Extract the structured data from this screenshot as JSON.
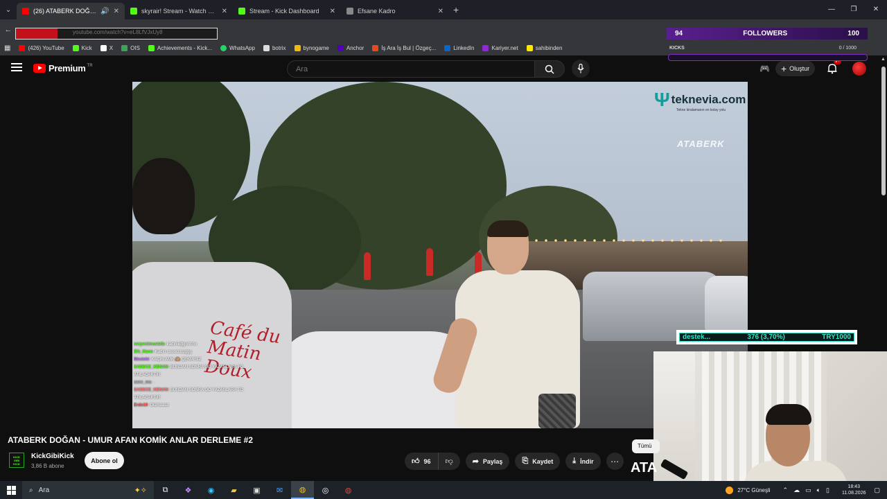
{
  "browser": {
    "tabs": [
      {
        "title": "(26) ATABERK DOĞAN - UM",
        "active": true,
        "color": "#ff0000"
      },
      {
        "title": "skyrair! Stream - Watch Live on",
        "active": false,
        "color": "#53fc18"
      },
      {
        "title": "Stream - Kick Dashboard",
        "active": false,
        "color": "#53fc18"
      },
      {
        "title": "Efsane Kadro",
        "active": false,
        "color": "#888888"
      }
    ],
    "url": "youtube.com/watch?v=eL8LfVJxUy8",
    "bookmarks": [
      {
        "label": "(426) YouTube",
        "color": "#ff0000"
      },
      {
        "label": "Kick",
        "color": "#53fc18"
      },
      {
        "label": "X",
        "color": "#ffffff"
      },
      {
        "label": "OIS",
        "color": "#3aa45a"
      },
      {
        "label": "Achievements - Kick...",
        "color": "#53fc18"
      },
      {
        "label": "WhatsApp",
        "color": "#25d366"
      },
      {
        "label": "botrix",
        "color": "#dddddd"
      },
      {
        "label": "bynogame",
        "color": "#f5b80a"
      },
      {
        "label": "Anchor",
        "color": "#5000b9"
      },
      {
        "label": "İş Ara İş Bul | Özgeç...",
        "color": "#e8481c"
      },
      {
        "label": "LinkedIn",
        "color": "#0a66c2"
      },
      {
        "label": "Kariyer.net",
        "color": "#8e2ad2"
      },
      {
        "label": "sahibinden",
        "color": "#ffe800"
      }
    ]
  },
  "overlay": {
    "followers_current": "94",
    "followers_label": "FOLLOWERS",
    "followers_goal": "100",
    "kicks_label": "KICKS",
    "kicks_value": "0 / 1000"
  },
  "youtube": {
    "premium_label": "Premium",
    "tr_label": "TR",
    "search_placeholder": "Ara",
    "create_label": "Oluştur",
    "notif_count": "9+"
  },
  "video": {
    "sponsor_name": "teknevia.com",
    "sponsor_tagline": "Tekne kiralamanın en kolay yolu",
    "watermark": "ATABERK",
    "shirt_print": "Café du Matin Doux",
    "chat": [
      {
        "user": "serpentmustafa",
        "msg": "kadıniiiiğgnnnnn",
        "color": "#53fc18"
      },
      {
        "user": "Efe_Hann",
        "msg": "Kadın cuuuccuuggg",
        "color": "#53fc18"
      },
      {
        "user": "Mestekt",
        "msg": "KAÇIN AMK 🙈 ÇEKMİSİZ",
        "color": "#c06cff"
      },
      {
        "user": "SADECE_KENAN",
        "msg": "BUNDAN SONRA GO YAZANLARA TO",
        "color": "#53fc18"
      },
      {
        "user": "",
        "msg": "ATILACAKTIR",
        "color": "#ffffff"
      },
      {
        "user": "zane_ma",
        "msg": ":",
        "color": "#aaaaaa"
      },
      {
        "user": "SADECE_KENAN",
        "msg": "BUNDAN SONRA GO YAZANLARA TO",
        "color": "#ff7a7a"
      },
      {
        "user": "",
        "msg": "ATILACAKTIR",
        "color": "#ffffff"
      },
      {
        "user": "Erdo10",
        "msg": "Olamaaaz",
        "color": "#ff4d4d"
      }
    ]
  },
  "donation": {
    "label": "destek...",
    "progress": "376 (3,70%)",
    "goal": "TRY1000",
    "fraction": 0.037
  },
  "meta": {
    "title": "ATABERK DOĞAN - UMUR AFAN KOMİK ANLAR DERLEME #2",
    "channel": "KickGibiKick",
    "subs": "3,86 B abone",
    "subscribe": "Abone ol",
    "likes": "96",
    "share": "Paylaş",
    "save": "Kaydet",
    "download": "İndir",
    "chip": "Tümü",
    "side_text": "ATA"
  },
  "taskbar": {
    "search": "Ara",
    "weather": "27°C Güneşli",
    "time": "18:43",
    "date": "11.08.2026"
  }
}
